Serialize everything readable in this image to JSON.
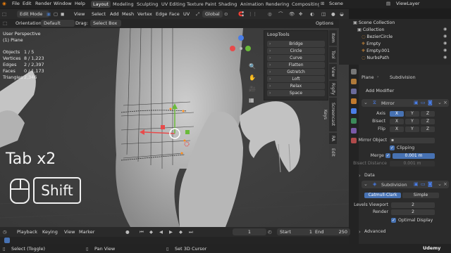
{
  "topbar": {
    "menu": [
      "File",
      "Edit",
      "Render",
      "Window",
      "Help"
    ],
    "workspaces": [
      "Layout",
      "Modeling",
      "Sculpting",
      "UV Editing",
      "Texture Paint",
      "Shading",
      "Animation",
      "Rendering",
      "Compositing"
    ],
    "active_workspace": "Layout",
    "scene_label": "Scene",
    "viewlayer_label": "ViewLayer"
  },
  "viewport_header": {
    "mode": "Edit Mode",
    "menus": [
      "View",
      "Select",
      "Add",
      "Mesh",
      "Vertex",
      "Edge",
      "Face",
      "UV"
    ],
    "transform": "Global",
    "orientation_label": "Orientation:",
    "orientation_value": "Default",
    "drag_label": "Drag:",
    "drag_value": "Select Box",
    "options": "Options"
  },
  "viewport": {
    "perspective": "User Perspective",
    "object": "(1) Plane",
    "stats": [
      {
        "label": "Objects",
        "value": "1 / 5"
      },
      {
        "label": "Vertices",
        "value": "8 / 1,223"
      },
      {
        "label": "Edges",
        "value": "2 / 2,397"
      },
      {
        "label": "Faces",
        "value": "0 / 1,173"
      },
      {
        "label": "Triangles",
        "value": "2,346"
      }
    ],
    "overlay_key_text": "Tab x2",
    "overlay_shift": "Shift"
  },
  "looptools": {
    "title": "LoopTools",
    "buttons": [
      "Bridge",
      "Circle",
      "Curve",
      "Flatten",
      "Gstretch",
      "Loft",
      "Relax",
      "Space"
    ]
  },
  "side_tabs": [
    "Item",
    "Tool",
    "View",
    "Rigify",
    "Screencast Keys",
    "RA",
    "Edit"
  ],
  "outliner": {
    "title": "Scene Collection",
    "items": [
      "Collection",
      "BezierCircle",
      "Empty",
      "Empty.001",
      "NurbsPath"
    ]
  },
  "properties": {
    "object_name": "Plane",
    "modifier_name": "Subdivision",
    "add_modifier": "Add Modifier",
    "mirror": {
      "name": "Mirror",
      "axis_label": "Axis",
      "bisect_label": "Bisect",
      "flip_label": "Flip",
      "axes": [
        "X",
        "Y",
        "Z"
      ],
      "mirror_object_label": "Mirror Object",
      "clipping_label": "Clipping",
      "merge_label": "Merge",
      "merge_value": "0.001 m",
      "bisect_distance_label": "Bisect Distance",
      "bisect_distance_value": "0.001 m",
      "data_label": "Data"
    },
    "subdivision": {
      "name": "Subdivision",
      "catmull": "Catmull-Clark",
      "simple": "Simple",
      "levels_viewport_label": "Levels Viewport",
      "levels_viewport_value": "2",
      "render_label": "Render",
      "render_value": "2",
      "optimal_label": "Optimal Display",
      "advanced_label": "Advanced"
    }
  },
  "timeline": {
    "menus": [
      "Playback",
      "Keying",
      "View",
      "Marker"
    ],
    "current_frame": "1",
    "start_label": "Start",
    "start_value": "1",
    "end_label": "End",
    "end_value": "250"
  },
  "statusbar": {
    "items": [
      "Select (Toggle)",
      "Pan View",
      "Set 3D Cursor"
    ],
    "watermark": "Udemy"
  }
}
